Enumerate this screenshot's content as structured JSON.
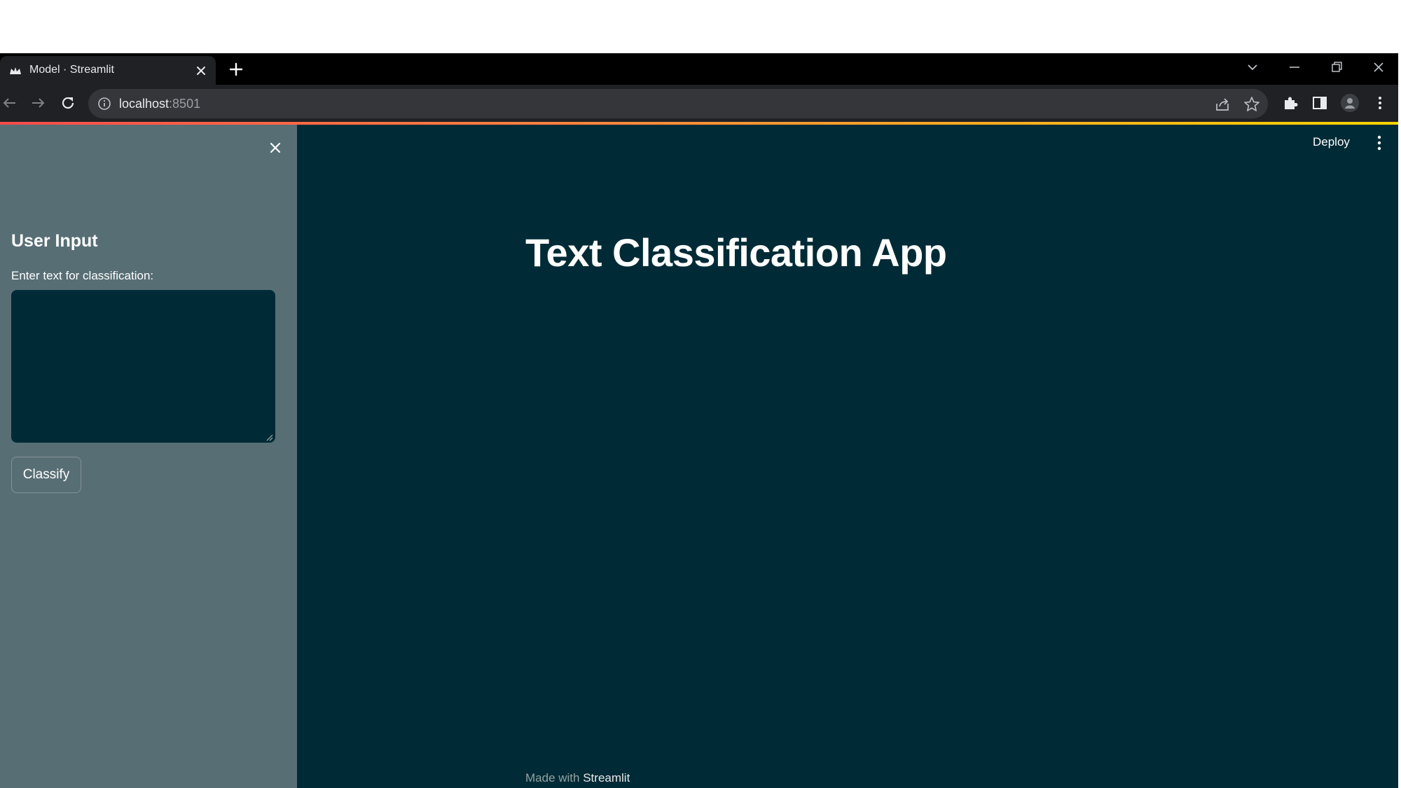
{
  "browser": {
    "tab": {
      "title": "Model · Streamlit",
      "favicon": "streamlit-crown-icon"
    },
    "address_bar": {
      "host": "localhost",
      "port": ":8501"
    },
    "icons": {
      "back": "back-arrow-icon",
      "forward": "forward-arrow-icon",
      "reload": "reload-icon",
      "share": "share-icon",
      "bookmark": "star-icon",
      "extensions": "puzzle-icon",
      "side_panel": "side-panel-icon",
      "profile": "avatar",
      "menu": "kebab-menu-icon"
    }
  },
  "sidebar": {
    "title": "User Input",
    "input_label": "Enter text for classification:",
    "textarea_value": "",
    "button_label": "Classify",
    "close_icon": "close-icon"
  },
  "header": {
    "deploy_label": "Deploy",
    "menu_icon": "kebab-menu-icon"
  },
  "main": {
    "title": "Text Classification App"
  },
  "footer": {
    "prefix": "Made with",
    "brand": "Streamlit"
  },
  "theme": {
    "app_background": "#002b36",
    "sidebar_background": "#586e75",
    "text_color": "#ffffff",
    "accent": "#ff4b4b"
  }
}
